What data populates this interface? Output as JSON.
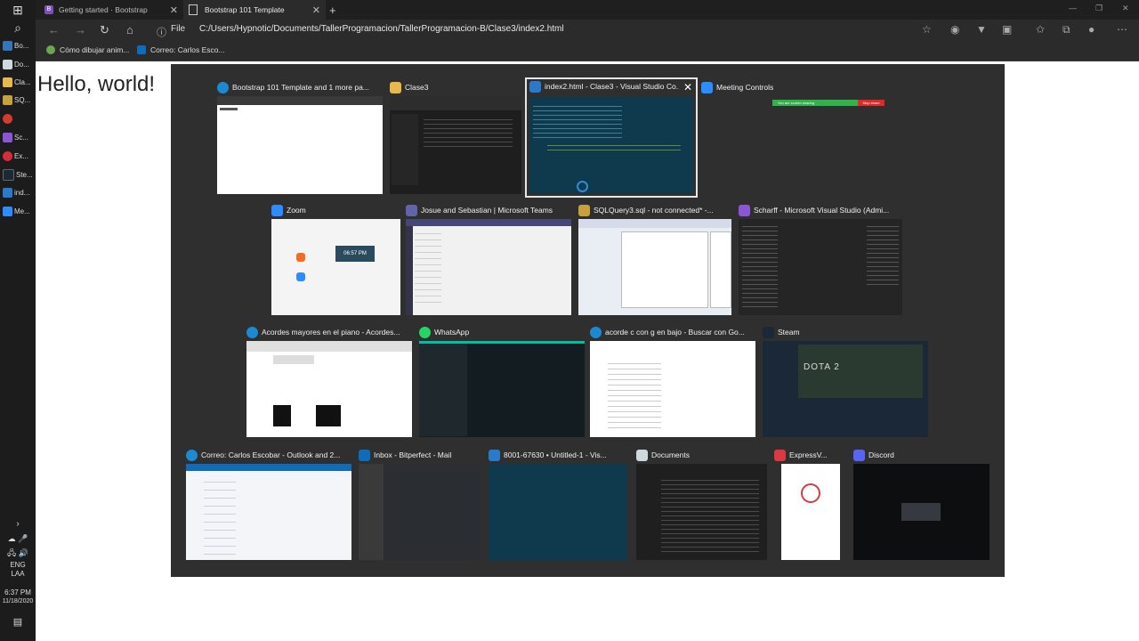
{
  "browser": {
    "tabs": [
      {
        "label": "Getting started · Bootstrap",
        "icon": "bootstrap-icon"
      },
      {
        "label": "Bootstrap 101 Template",
        "icon": "page-icon"
      }
    ],
    "address": {
      "scheme_label": "File",
      "url": "C:/Users/Hypnotic/Documents/TallerProgramacion/TallerProgramacion-B/Clase3/index2.html"
    },
    "favorites": [
      {
        "label": "Cómo dibujar anim...",
        "icon": "leaf-icon"
      },
      {
        "label": "Correo: Carlos Esco...",
        "icon": "outlook-icon"
      }
    ]
  },
  "page": {
    "heading": "Hello, world!"
  },
  "taskbar": {
    "apps": [
      {
        "label": "Bo...",
        "color": "#3277bc"
      },
      {
        "label": "Do...",
        "color": "#cfd8dc"
      },
      {
        "label": "Cla...",
        "color": "#e8b84a"
      },
      {
        "label": "SQ...",
        "color": "#c8a13b"
      },
      {
        "label": "",
        "color": "#d63a2f"
      },
      {
        "label": "Sc...",
        "color": "#8a56d6"
      },
      {
        "label": "Ex...",
        "color": "#d62d3a"
      },
      {
        "label": "Ste...",
        "color": "#1b2838"
      },
      {
        "label": "ind...",
        "color": "#2a7acc"
      },
      {
        "label": "Me...",
        "color": "#2d8cff"
      }
    ],
    "lang": "ENG",
    "lang2": "LAA",
    "time": "6:37 PM",
    "date": "11/18/2020"
  },
  "task_view": {
    "windows": [
      {
        "title": "Bootstrap 101 Template and 1 more pa...",
        "icon_color": "#1b8ad3",
        "thumb": "#ffffff"
      },
      {
        "title": "Clase3",
        "icon_color": "#e8b84a",
        "thumb": "#1e1e1e"
      },
      {
        "title": "index2.html - Clase3 - Visual Studio Co...",
        "icon_color": "#2a7acc",
        "thumb": "#0f3a4d",
        "selected": true
      },
      {
        "title": "Meeting Controls",
        "icon_color": "#2d8cff",
        "thumb": "#2f2f2f"
      },
      {
        "title": "Zoom",
        "icon_color": "#2d8cff",
        "thumb": "#f4f4f4"
      },
      {
        "title": "Josue and Sebastian | Microsoft Teams",
        "icon_color": "#6264a7",
        "thumb": "#f1f1f1"
      },
      {
        "title": "SQLQuery3.sql - not connected* -...",
        "icon_color": "#c8a13b",
        "thumb": "#e9eef5"
      },
      {
        "title": "Scharff - Microsoft Visual Studio (Admi...",
        "icon_color": "#8a56d6",
        "thumb": "#252526"
      },
      {
        "title": "Acordes mayores en el piano - Acordes...",
        "icon_color": "#1b8ad3",
        "thumb": "#ffffff"
      },
      {
        "title": "WhatsApp",
        "icon_color": "#25d366",
        "thumb": "#131c21"
      },
      {
        "title": "acorde c con g en bajo - Buscar con Go...",
        "icon_color": "#1b8ad3",
        "thumb": "#ffffff"
      },
      {
        "title": "Steam",
        "icon_color": "#1b2838",
        "thumb": "#1b2838"
      },
      {
        "title": "Correo: Carlos Escobar - Outlook and 2...",
        "icon_color": "#1b8ad3",
        "thumb": "#f3f5f8"
      },
      {
        "title": "Inbox - Bitperfect - Mail",
        "icon_color": "#0f6cbd",
        "thumb": "#2a2d31"
      },
      {
        "title": "8001-67630 • Untitled-1 - Vis...",
        "icon_color": "#2a7acc",
        "thumb": "#0f3a4d"
      },
      {
        "title": "Documents",
        "icon_color": "#cfd8dc",
        "thumb": "#1f1f1f"
      },
      {
        "title": "ExpressV...",
        "icon_color": "#da3940",
        "thumb": "#ffffff"
      },
      {
        "title": "Discord",
        "icon_color": "#5865f2",
        "thumb": "#0d0e10"
      }
    ],
    "meeting_banner": {
      "text": "You are screen sharing",
      "stop_label": "Stop share"
    },
    "zoom_time": "06:57 PM",
    "steam_game": "DOTA 2"
  }
}
